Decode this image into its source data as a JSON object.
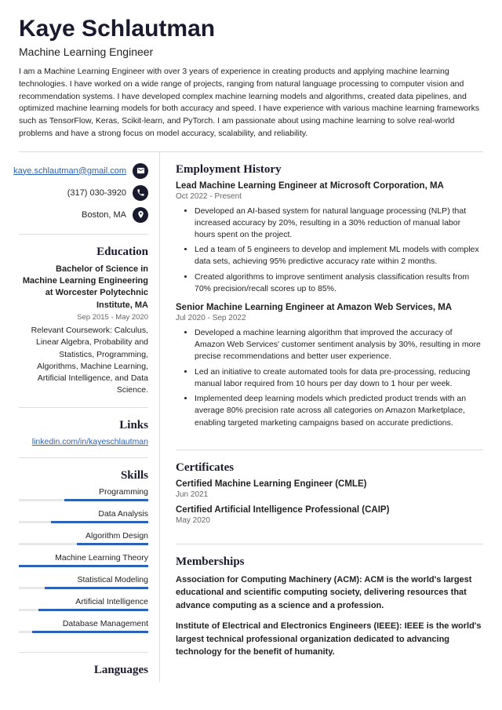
{
  "name": "Kaye Schlautman",
  "role": "Machine Learning Engineer",
  "summary": "I am a Machine Learning Engineer with over 3 years of experience in creating products and applying machine learning technologies. I have worked on a wide range of projects, ranging from natural language processing to computer vision and recommendation systems. I have developed complex machine learning models and algorithms, created data pipelines, and optimized machine learning models for both accuracy and speed. I have experience with various machine learning frameworks such as TensorFlow, Keras, Scikit-learn, and PyTorch. I am passionate about using machine learning to solve real-world problems and have a strong focus on model accuracy, scalability, and reliability.",
  "contact": {
    "email": "kaye.schlautman@gmail.com",
    "phone": "(317) 030-3920",
    "location": "Boston, MA"
  },
  "sections": {
    "education": "Education",
    "links": "Links",
    "skills": "Skills",
    "languages": "Languages",
    "employment": "Employment History",
    "certificates": "Certificates",
    "memberships": "Memberships"
  },
  "education": {
    "degree": "Bachelor of Science in Machine Learning Engineering at Worcester Polytechnic Institute, MA",
    "date": "Sep 2015 - May 2020",
    "desc": "Relevant Coursework: Calculus, Linear Algebra, Probability and Statistics, Programming, Algorithms, Machine Learning, Artificial Intelligence, and Data Science."
  },
  "links": {
    "linkedin": "linkedin.com/in/kayeschlautman"
  },
  "skills": [
    {
      "name": "Programming",
      "pct": 65
    },
    {
      "name": "Data Analysis",
      "pct": 75
    },
    {
      "name": "Algorithm Design",
      "pct": 55
    },
    {
      "name": "Machine Learning Theory",
      "pct": 100
    },
    {
      "name": "Statistical Modeling",
      "pct": 80
    },
    {
      "name": "Artificial Intelligence",
      "pct": 85
    },
    {
      "name": "Database Management",
      "pct": 90
    }
  ],
  "jobs": [
    {
      "title": "Lead Machine Learning Engineer at Microsoft Corporation, MA",
      "date": "Oct 2022 - Present",
      "bullets": [
        "Developed an AI-based system for natural language processing (NLP) that increased accuracy by 20%, resulting in a 30% reduction of manual labor hours spent on the project.",
        "Led a team of 5 engineers to develop and implement ML models with complex data sets, achieving 95% predictive accuracy rate within 2 months.",
        "Created algorithms to improve sentiment analysis classification results from 70% precision/recall scores up to 85%."
      ]
    },
    {
      "title": "Senior Machine Learning Engineer at Amazon Web Services, MA",
      "date": "Jul 2020 - Sep 2022",
      "bullets": [
        "Developed a machine learning algorithm that improved the accuracy of Amazon Web Services' customer sentiment analysis by 30%, resulting in more precise recommendations and better user experience.",
        "Led an initiative to create automated tools for data pre-processing, reducing manual labor required from 10 hours per day down to 1 hour per week.",
        "Implemented deep learning models which predicted product trends with an average 80% precision rate across all categories on Amazon Marketplace, enabling targeted marketing campaigns based on accurate predictions."
      ]
    }
  ],
  "certs": [
    {
      "title": "Certified Machine Learning Engineer (CMLE)",
      "date": "Jun 2021"
    },
    {
      "title": "Certified Artificial Intelligence Professional (CAIP)",
      "date": "May 2020"
    }
  ],
  "memberships": [
    "Association for Computing Machinery (ACM): ACM is the world's largest educational and scientific computing society, delivering resources that advance computing as a science and a profession.",
    "Institute of Electrical and Electronics Engineers (IEEE): IEEE is the world's largest technical professional organization dedicated to advancing technology for the benefit of humanity."
  ]
}
